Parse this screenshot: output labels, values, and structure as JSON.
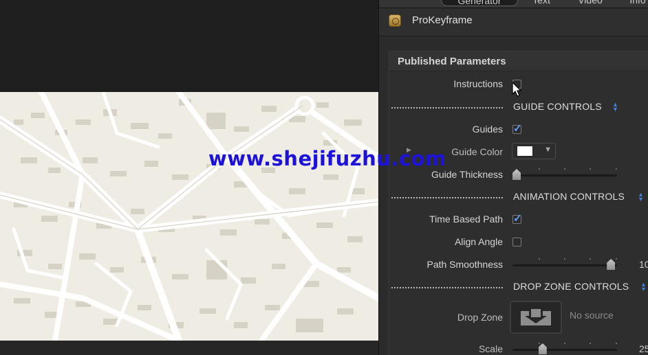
{
  "tabs": [
    {
      "label": "Generator",
      "active": true
    },
    {
      "label": "Text",
      "active": false
    },
    {
      "label": "Video",
      "active": false
    },
    {
      "label": "Info",
      "active": false
    }
  ],
  "inspector": {
    "title": "ProKeyframe",
    "panel_title": "Published Parameters"
  },
  "params": {
    "instructions_label": "Instructions",
    "guide_section": "GUIDE CONTROLS",
    "guides_label": "Guides",
    "guide_color_label": "Guide Color",
    "guide_thickness_label": "Guide Thickness",
    "animation_section": "ANIMATION CONTROLS",
    "time_path_label": "Time Based Path",
    "align_angle_label": "Align Angle",
    "path_smooth_label": "Path Smoothness",
    "path_smooth_value": "10",
    "drop_section": "DROP ZONE CONTROLS",
    "drop_zone_label": "Drop Zone",
    "drop_zone_status": "No source",
    "scale_label": "Scale",
    "scale_value": "25"
  },
  "state": {
    "instructions": false,
    "guides": true,
    "time_based_path": true,
    "align_angle": false,
    "guide_thickness": 0.0,
    "path_smoothness": 0.98,
    "scale": 0.27
  },
  "colors": {
    "guide_color": "#ffffff",
    "accent": "#5fa2ff",
    "map_background": "#efece4"
  },
  "watermark": "www.shejifuzhu.com"
}
